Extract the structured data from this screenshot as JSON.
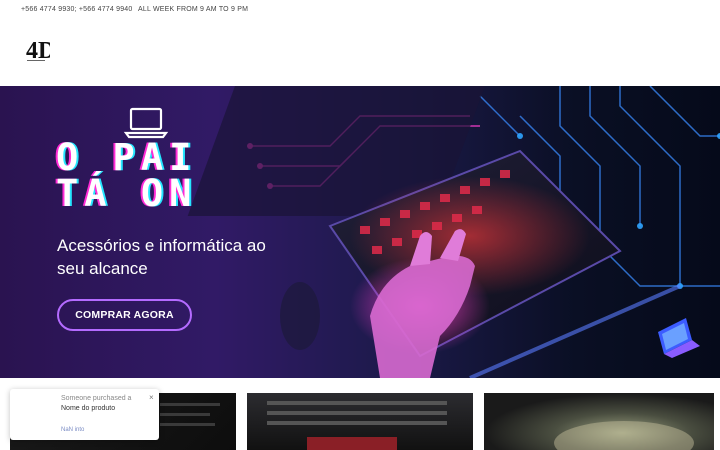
{
  "topbar": {
    "phones": "+566 4774 9930; +566 4774 9940",
    "hours": "ALL WEEK FROM 9 AM TO 9 PM"
  },
  "logo": {
    "text": "4D",
    "icon": "logo-mark"
  },
  "hero": {
    "headline_line1": "O PAI",
    "headline_line2": "TÁ ON",
    "subheading": "Acessórios e informática ao seu alcance",
    "cta_label": "COMPRAR AGORA",
    "accent_color": "#b46bff",
    "icons": [
      "laptop-outline-icon",
      "laptop-3d-icon"
    ]
  },
  "notification": {
    "title": "Someone purchased a",
    "product": "Nome do produto",
    "timestamp": "NaN into",
    "close": "×"
  }
}
